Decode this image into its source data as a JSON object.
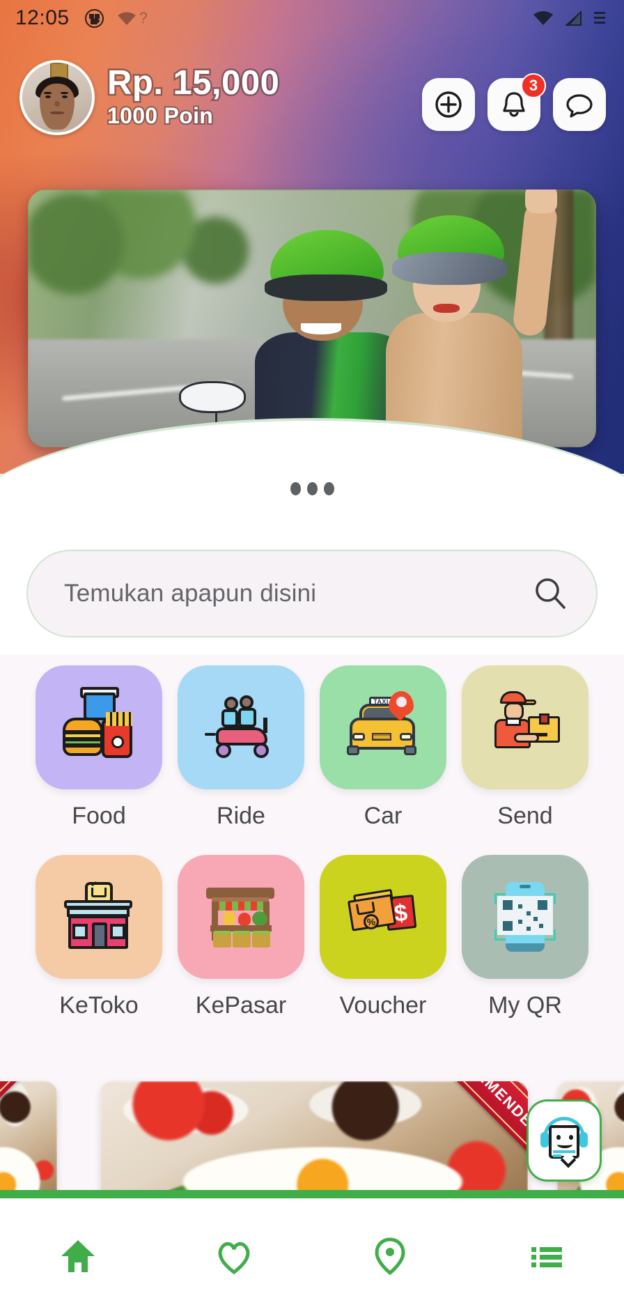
{
  "status_bar": {
    "time": "12:05",
    "left_icons": [
      "app-badge-icon",
      "wifi-unknown-icon"
    ],
    "right_icons": [
      "wifi-icon",
      "cellular-signal-icon",
      "battery-icon"
    ],
    "unknown_marker": "?"
  },
  "header": {
    "balance": "Rp. 15,000",
    "points": "1000 Poin",
    "avatar_name": "user-avatar",
    "actions": [
      {
        "name": "top-up-button",
        "icon": "plus-circle-icon",
        "badge": null
      },
      {
        "name": "notifications-button",
        "icon": "bell-icon",
        "badge": "3"
      },
      {
        "name": "messages-button",
        "icon": "chat-bubble-icon",
        "badge": null
      }
    ],
    "gradient_from": "#e8733f",
    "gradient_mid": "#a46a9c",
    "gradient_to": "#22307f"
  },
  "banner": {
    "name": "promo-banner",
    "alt": "driver and passenger on motorbike",
    "carousel_dots": 3,
    "active_dot": 0
  },
  "search": {
    "placeholder": "Temukan apapun disini",
    "value": "",
    "icon": "search-icon"
  },
  "services": [
    {
      "label": "Food",
      "icon": "food-icon",
      "color": "#c3b5f5"
    },
    {
      "label": "Ride",
      "icon": "ride-icon",
      "color": "#a6d9f5"
    },
    {
      "label": "Car",
      "icon": "car-icon",
      "color": "#9adfa8"
    },
    {
      "label": "Send",
      "icon": "send-icon",
      "color": "#e4dfae"
    },
    {
      "label": "KeToko",
      "icon": "store-icon",
      "color": "#f5cba6"
    },
    {
      "label": "KePasar",
      "icon": "market-icon",
      "color": "#f7a8b4"
    },
    {
      "label": "Voucher",
      "icon": "voucher-icon",
      "color": "#ccd31f"
    },
    {
      "label": "My QR",
      "icon": "qr-icon",
      "color": "#a9bdb2"
    }
  ],
  "recommendations": {
    "ribbon_label": "RECOMMENDED",
    "cards": [
      {
        "name": "recommendation-card-prev",
        "alt": "food photo"
      },
      {
        "name": "recommendation-card-main",
        "alt": "fried egg with chili and herbs"
      },
      {
        "name": "recommendation-card-next",
        "alt": "food photo"
      }
    ]
  },
  "chat_fab": {
    "name": "chatbot-button",
    "icon": "chatbot-headset-icon",
    "accent": "#3fae49"
  },
  "bottom_nav": {
    "accent": "#3fae49",
    "active_index": 0,
    "items": [
      {
        "name": "nav-home",
        "icon": "home-icon"
      },
      {
        "name": "nav-favorites",
        "icon": "heart-icon"
      },
      {
        "name": "nav-location",
        "icon": "location-pin-icon"
      },
      {
        "name": "nav-menu",
        "icon": "list-menu-icon"
      }
    ]
  }
}
